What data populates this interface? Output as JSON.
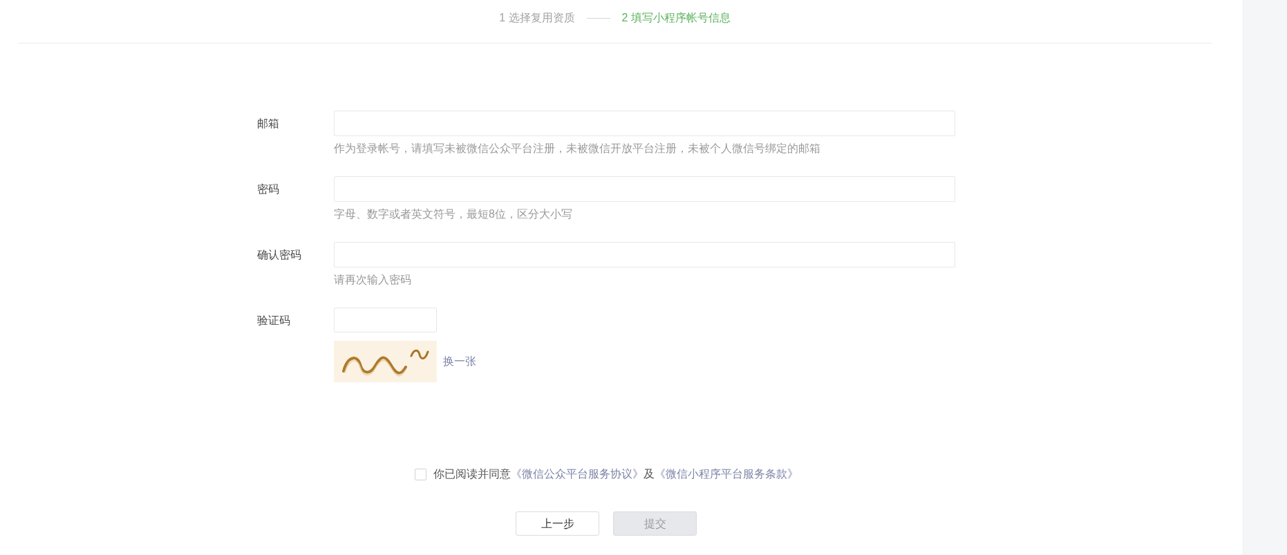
{
  "steps": [
    {
      "label": "1 选择复用资质",
      "selected": false
    },
    {
      "label": "2 填写小程序帐号信息",
      "selected": true
    }
  ],
  "form": {
    "fields": [
      {
        "kind": "text",
        "label": "邮箱",
        "hint": "作为登录帐号，请填写未被微信公众平台注册，未被微信开放平台注册，未被个人微信号绑定的邮箱"
      },
      {
        "kind": "password",
        "label": "密码",
        "hint": "字母、数字或者英文符号，最短8位，区分大小写"
      },
      {
        "kind": "password",
        "label": "确认密码",
        "hint": "请再次输入密码"
      },
      {
        "kind": "captcha",
        "label": "验证码",
        "refresh_link": "换一张"
      }
    ]
  },
  "agreement": {
    "checked": false,
    "parts": [
      {
        "kind": "text",
        "text": "你已阅读并同意"
      },
      {
        "kind": "link",
        "text": "《微信公众平台服务协议》"
      },
      {
        "kind": "text",
        "text": "及"
      },
      {
        "kind": "link",
        "text": "《微信小程序平台服务条款》"
      }
    ]
  },
  "buttons": [
    {
      "label": "上一步",
      "disabled": false
    },
    {
      "label": "提交",
      "disabled": true
    }
  ]
}
